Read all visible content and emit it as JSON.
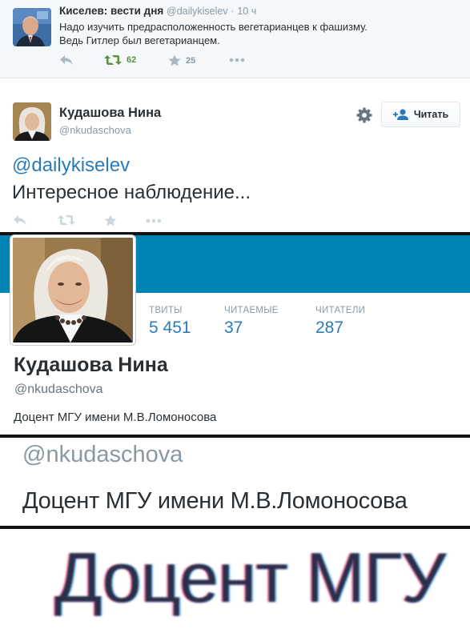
{
  "quoted_tweet": {
    "author_name": "Киселев: вести дня",
    "author_handle": "@dailykiselev",
    "separator": "·",
    "time": "10 ч",
    "text_line1": "Надо изучить предрасположенность вегетарианцев к фашизму.",
    "text_line2": "Ведь Гитлер был вегетарианцем.",
    "retweets": "62",
    "favorites": "25",
    "colors": {
      "retweet": "#5c913b",
      "icon": "#aab8c2"
    }
  },
  "tweet": {
    "author_name": "Кудашова Нина",
    "author_handle": "@nkudaschova",
    "follow_label": "Читать",
    "mention": "@dailykiselev",
    "text": "Интересное наблюдение..."
  },
  "profile": {
    "stats": [
      {
        "label": "ТВИТЫ",
        "value": "5 451"
      },
      {
        "label": "ЧИТАЕМЫЕ",
        "value": "37"
      },
      {
        "label": "ЧИТАТЕЛИ",
        "value": "287"
      }
    ],
    "name": "Кудашова Нина",
    "handle": "@nkudaschova",
    "bio": "Доцент МГУ имени М.В.Ломоносова",
    "colors": {
      "banner": "#0084b4",
      "link": "#2b7bb9"
    }
  },
  "zoom": {
    "handle": "@nkudaschova",
    "bio": "Доцент МГУ имени М.В.Ломоносова"
  },
  "big_zoom": {
    "text": "Доцент МГУ"
  }
}
